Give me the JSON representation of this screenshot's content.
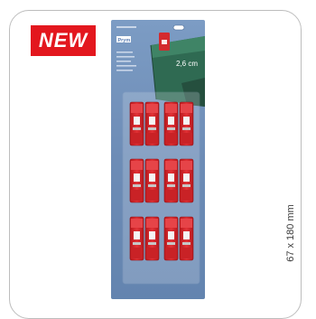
{
  "badge": {
    "label": "NEW",
    "color": "#e3171e"
  },
  "product": {
    "brand": "Prym",
    "size_label": "2,6 cm",
    "dimensions": "67 x 180 mm",
    "clip_color": "#d42a2e",
    "card_color": "#6f8fb8",
    "fabric_color": "#2f6a52"
  }
}
